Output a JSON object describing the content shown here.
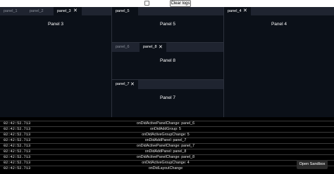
{
  "controls": {
    "clear_logs_label": "Clear logs"
  },
  "groups": {
    "left": {
      "tabs": [
        {
          "label": "panel_1"
        },
        {
          "label": "panel_2"
        },
        {
          "label": "panel_3"
        }
      ],
      "content": "Panel 3"
    },
    "middle_top": {
      "tabs": [
        {
          "label": "panel_5"
        }
      ],
      "content": "Panel 5"
    },
    "right": {
      "tabs": [
        {
          "label": "panel_4"
        }
      ],
      "content": "Panel 4"
    },
    "middle_mid": {
      "tabs": [
        {
          "label": "panel_6"
        },
        {
          "label": "panel_8"
        }
      ],
      "content": "Panel 8"
    },
    "middle_bottom": {
      "tabs": [
        {
          "label": "panel_7"
        }
      ],
      "content": "Panel 7"
    }
  },
  "close_glyph": "✕",
  "log": {
    "rows": [
      {
        "time": "02:42:52.713",
        "message": "onDidActivePanelChange: panel_6"
      },
      {
        "time": "02:42:52.713",
        "message": "onDidAddGroup: 5"
      },
      {
        "time": "02:42:52.713",
        "message": "onDidActiveGroupChange: 5"
      },
      {
        "time": "02:42:52.713",
        "message": "onDidAddPanel: panel_7"
      },
      {
        "time": "02:42:52.713",
        "message": "onDidActivePanelChange: panel_7"
      },
      {
        "time": "02:42:52.713",
        "message": "onDidAddPanel: panel_8"
      },
      {
        "time": "02:42:52.713",
        "message": "onDidActivePanelChange: panel_8"
      },
      {
        "time": "02:42:52.713",
        "message": "onDidActiveGroupChange: 4"
      },
      {
        "time": "02:42:52.713",
        "message": "onDidLayoutChange"
      }
    ]
  },
  "sandbox": {
    "label": "Open Sandbox"
  }
}
